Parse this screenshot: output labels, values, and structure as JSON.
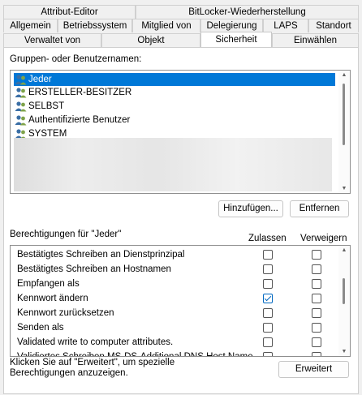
{
  "tabs": {
    "row1": [
      {
        "label": "Attribut-Editor"
      },
      {
        "label": "BitLocker-Wiederherstellung"
      }
    ],
    "row2": [
      {
        "label": "Allgemein"
      },
      {
        "label": "Betriebssystem"
      },
      {
        "label": "Mitglied von"
      },
      {
        "label": "Delegierung"
      },
      {
        "label": "LAPS"
      },
      {
        "label": "Standort"
      }
    ],
    "row3": [
      {
        "label": "Verwaltet von"
      },
      {
        "label": "Objekt"
      },
      {
        "label": "Sicherheit"
      },
      {
        "label": "Einwählen"
      }
    ],
    "active": "Sicherheit"
  },
  "groups": {
    "label": "Gruppen- oder Benutzernamen:",
    "items": [
      {
        "name": "Jeder",
        "selected": true
      },
      {
        "name": "ERSTELLER-BESITZER",
        "selected": false
      },
      {
        "name": "SELBST",
        "selected": false
      },
      {
        "name": "Authentifizierte Benutzer",
        "selected": false
      },
      {
        "name": "SYSTEM",
        "selected": false
      }
    ],
    "add_button": "Hinzufügen...",
    "remove_button": "Entfernen"
  },
  "permissions": {
    "label": "Berechtigungen für \"Jeder\"",
    "allow_header": "Zulassen",
    "deny_header": "Verweigern",
    "rows": [
      {
        "name": "Bestätigtes Schreiben an Dienstprinzipal",
        "allow": false,
        "deny": false
      },
      {
        "name": "Bestätigtes Schreiben an Hostnamen",
        "allow": false,
        "deny": false
      },
      {
        "name": "Empfangen als",
        "allow": false,
        "deny": false
      },
      {
        "name": "Kennwort ändern",
        "allow": true,
        "deny": false
      },
      {
        "name": "Kennwort zurücksetzen",
        "allow": false,
        "deny": false
      },
      {
        "name": "Senden als",
        "allow": false,
        "deny": false
      },
      {
        "name": "Validated write to computer attributes.",
        "allow": false,
        "deny": false
      },
      {
        "name": "Validiertes Schreiben MS-DS-Additional DNS Host Name",
        "allow": false,
        "deny": false
      }
    ]
  },
  "advanced": {
    "hint": "Klicken Sie auf \"Erweitert\", um spezielle Berechtigungen anzuzeigen.",
    "button": "Erweitert"
  },
  "colors": {
    "selection": "#0078d7",
    "checkbox_checked": "#0067c0"
  }
}
